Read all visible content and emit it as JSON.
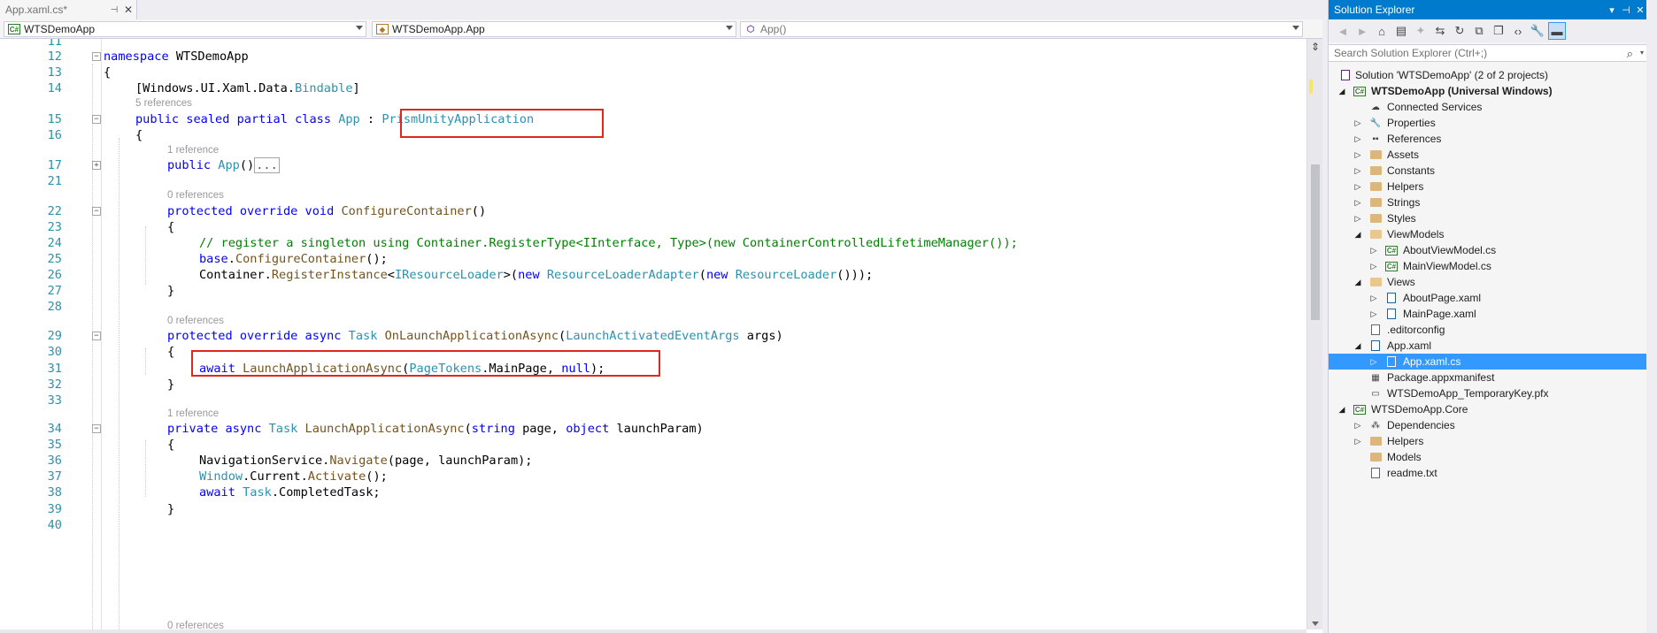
{
  "editor": {
    "tab": {
      "label": "App.xaml.cs*",
      "pin_glyph": "⊣",
      "close_glyph": "✕"
    },
    "nav": {
      "project": "WTSDemoApp",
      "type": "WTSDemoApp.App",
      "member": "App()"
    },
    "lines": [
      {
        "n": "11",
        "text": ""
      },
      {
        "n": "12",
        "text": "namespace WTSDemoApp"
      },
      {
        "n": "13",
        "text": "{"
      },
      {
        "n": "14",
        "text": "[Windows.UI.Xaml.Data.Bindable]"
      },
      {
        "lens": "5 references"
      },
      {
        "n": "15",
        "text": "public sealed partial class App : PrismUnityApplication"
      },
      {
        "n": "16",
        "text": "{"
      },
      {
        "lens": "1 reference"
      },
      {
        "n": "17",
        "text": "public App()..."
      },
      {
        "n": "21",
        "text": ""
      },
      {
        "lens": "0 references"
      },
      {
        "n": "22",
        "text": "protected override void ConfigureContainer()"
      },
      {
        "n": "23",
        "text": "{"
      },
      {
        "n": "24",
        "text": "// register a singleton using Container.RegisterType<IInterface, Type>(new ContainerControlledLifetimeManager());"
      },
      {
        "n": "25",
        "text": "base.ConfigureContainer();"
      },
      {
        "n": "26",
        "text": "Container.RegisterInstance<IResourceLoader>(new ResourceLoaderAdapter(new ResourceLoader()));"
      },
      {
        "n": "27",
        "text": "}"
      },
      {
        "n": "28",
        "text": ""
      },
      {
        "lens": "0 references"
      },
      {
        "n": "29",
        "text": "protected override async Task OnLaunchApplicationAsync(LaunchActivatedEventArgs args)"
      },
      {
        "n": "30",
        "text": "{"
      },
      {
        "n": "31",
        "text": "await LaunchApplicationAsync(PageTokens.MainPage, null);"
      },
      {
        "n": "32",
        "text": "}"
      },
      {
        "n": "33",
        "text": ""
      },
      {
        "lens": "1 reference"
      },
      {
        "n": "34",
        "text": "private async Task LaunchApplicationAsync(string page, object launchParam)"
      },
      {
        "n": "35",
        "text": "{"
      },
      {
        "n": "36",
        "text": "NavigationService.Navigate(page, launchParam);"
      },
      {
        "n": "37",
        "text": "Window.Current.Activate();"
      },
      {
        "n": "38",
        "text": "await Task.CompletedTask;"
      },
      {
        "n": "39",
        "text": "}"
      },
      {
        "n": "40",
        "text": ""
      },
      {
        "lens": "0 references"
      }
    ]
  },
  "solution_explorer": {
    "title": "Solution Explorer",
    "title_buttons": [
      "▾",
      "⊣",
      "✕"
    ],
    "search_placeholder": "Search Solution Explorer (Ctrl+;)",
    "toolbar_icons": [
      "back-icon",
      "forward-icon",
      "home-icon",
      "switch-views-icon",
      "pending-changes-icon",
      "sync-icon",
      "refresh-icon",
      "collapse-all-icon",
      "show-all-files-icon",
      "view-code-icon",
      "properties-icon",
      "preview-icon"
    ],
    "items": [
      {
        "label": "Solution 'WTSDemoApp' (2 of 2 projects)",
        "icon": "solution-icon"
      },
      {
        "label": "WTSDemoApp (Universal Windows)",
        "icon": "csproj-icon",
        "bold": true
      },
      {
        "label": "Connected Services",
        "icon": "connected-services-icon"
      },
      {
        "label": "Properties",
        "icon": "wrench-icon"
      },
      {
        "label": "References",
        "icon": "references-icon"
      },
      {
        "label": "Assets",
        "icon": "folder-icon"
      },
      {
        "label": "Constants",
        "icon": "folder-icon"
      },
      {
        "label": "Helpers",
        "icon": "folder-icon"
      },
      {
        "label": "Strings",
        "icon": "folder-icon"
      },
      {
        "label": "Styles",
        "icon": "folder-icon"
      },
      {
        "label": "ViewModels",
        "icon": "folder-open-icon"
      },
      {
        "label": "AboutViewModel.cs",
        "icon": "csharp-file-icon"
      },
      {
        "label": "MainViewModel.cs",
        "icon": "csharp-file-icon"
      },
      {
        "label": "Views",
        "icon": "folder-open-icon"
      },
      {
        "label": "AboutPage.xaml",
        "icon": "xaml-file-icon"
      },
      {
        "label": "MainPage.xaml",
        "icon": "xaml-file-icon"
      },
      {
        "label": ".editorconfig",
        "icon": "file-icon"
      },
      {
        "label": "App.xaml",
        "icon": "xaml-file-icon"
      },
      {
        "label": "App.xaml.cs",
        "icon": "csharp-file-icon",
        "selected": true
      },
      {
        "label": "Package.appxmanifest",
        "icon": "manifest-icon"
      },
      {
        "label": "WTSDemoApp_TemporaryKey.pfx",
        "icon": "certificate-icon"
      },
      {
        "label": "WTSDemoApp.Core",
        "icon": "csproj-icon"
      },
      {
        "label": "Dependencies",
        "icon": "dependencies-icon"
      },
      {
        "label": "Helpers",
        "icon": "folder-icon"
      },
      {
        "label": "Models",
        "icon": "folder-icon"
      },
      {
        "label": "readme.txt",
        "icon": "text-file-icon"
      }
    ]
  },
  "colors": {
    "accent": "#007ACC",
    "selection": "#3399FF",
    "keyword": "#0000FF",
    "type": "#2B91AF",
    "highlight_box": "#E0261F"
  }
}
